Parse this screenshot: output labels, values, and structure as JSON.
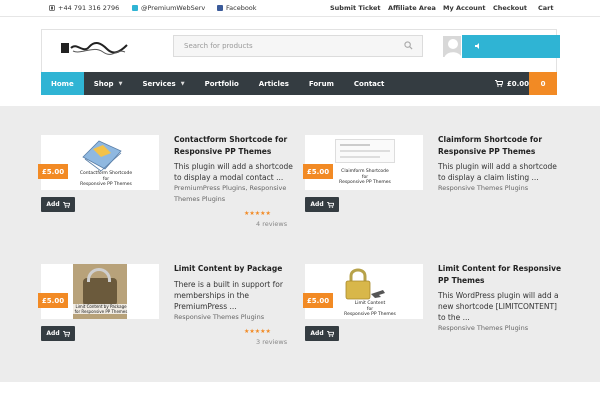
{
  "topbar": {
    "phone": "+44 791 316 2796",
    "twitter": "@PremiumWebServ",
    "facebook": "Facebook",
    "links": [
      "Submit Ticket",
      "Affiliate Area",
      "My Account",
      "Checkout",
      "Cart"
    ]
  },
  "header": {
    "search_placeholder": "Search for products"
  },
  "nav": {
    "items": [
      {
        "label": "Home"
      },
      {
        "label": "Shop"
      },
      {
        "label": "Services"
      },
      {
        "label": "Portfolio"
      },
      {
        "label": "Articles"
      },
      {
        "label": "Forum"
      },
      {
        "label": "Contact"
      }
    ],
    "cart_total": "£0.00",
    "cart_count": "0"
  },
  "products": [
    {
      "title": "Contactform Shortcode for Responsive PP Themes",
      "desc": "This plugin will add a shortcode to display a modal contact ...",
      "categories": "PremiumPress Plugins, Responsive Themes Plugins",
      "price": "£5.00",
      "add_label": "Add",
      "stars": "★★★★★",
      "reviews": "4 reviews",
      "image_caption": [
        "Contactform Shortcode",
        "for",
        "Responsive PP Themes"
      ]
    },
    {
      "title": "Claimform Shortcode for Responsive PP Themes",
      "desc": "This plugin will add a shortcode to display a claim listing ...",
      "categories": "Responsive Themes Plugins",
      "price": "£5.00",
      "add_label": "Add",
      "image_caption": [
        "Claimform Shortcode",
        "for",
        "Responsive PP Themes"
      ]
    },
    {
      "title": "Limit Content by Package",
      "desc": "There is a built in support for memberships in the PremiumPress ...",
      "categories": "Responsive Themes Plugins",
      "price": "£5.00",
      "add_label": "Add",
      "stars": "★★★★★",
      "reviews": "3 reviews",
      "image_caption": [
        "Limit Content by Package",
        "for Responsive PP Themes"
      ]
    },
    {
      "title": "Limit Content for Responsive PP Themes",
      "desc": "This WordPress plugin will add a new shortcode [LIMITCONTENT] to the ...",
      "categories": "Responsive Themes Plugins",
      "price": "£5.00",
      "add_label": "Add",
      "image_caption": [
        "Limit Content",
        "for",
        "Responsive PP Themes"
      ]
    }
  ],
  "colors": {
    "accent": "#2fb4d4",
    "orange": "#f28a24",
    "nav_bg": "#343c41"
  }
}
